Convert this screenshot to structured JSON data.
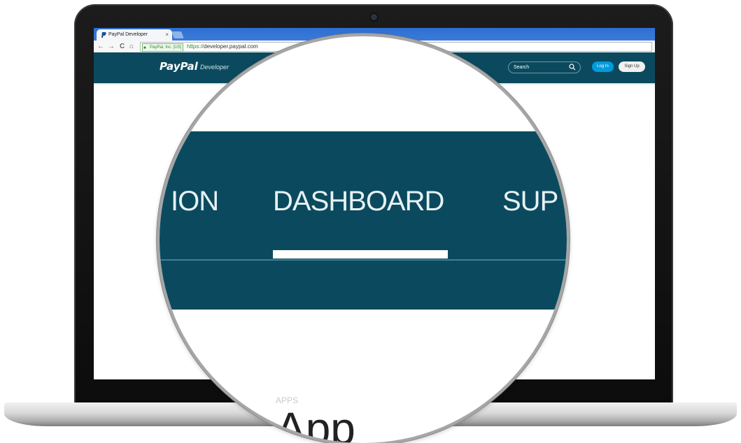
{
  "browser": {
    "tab_title": "PayPal Developer",
    "tab_close": "×",
    "ev_badge": "PayPal, Inc. [US]",
    "url_scheme": "https://",
    "url_host": "developer.paypal.com",
    "nav_back": "←",
    "nav_forward": "→",
    "nav_reload": "C",
    "nav_home": "⌂"
  },
  "header": {
    "logo": "PayPal",
    "logo_sub": "Developer",
    "search_placeholder": "Search",
    "login_label": "Log In",
    "signup_label": "Sign Up"
  },
  "magnified": {
    "nav_left": "ION",
    "nav_active": "DASHBOARD",
    "nav_right": "SUP",
    "app_label": "APPS",
    "app_text": "App"
  },
  "colors": {
    "header_bg": "#0b4a5e",
    "login_button": "#009cde",
    "tabstrip": "#2f6fd1"
  },
  "icons": [
    "paypal-favicon-icon",
    "lock-icon",
    "search-icon",
    "back-arrow-icon",
    "forward-arrow-icon",
    "reload-icon",
    "home-icon"
  ]
}
